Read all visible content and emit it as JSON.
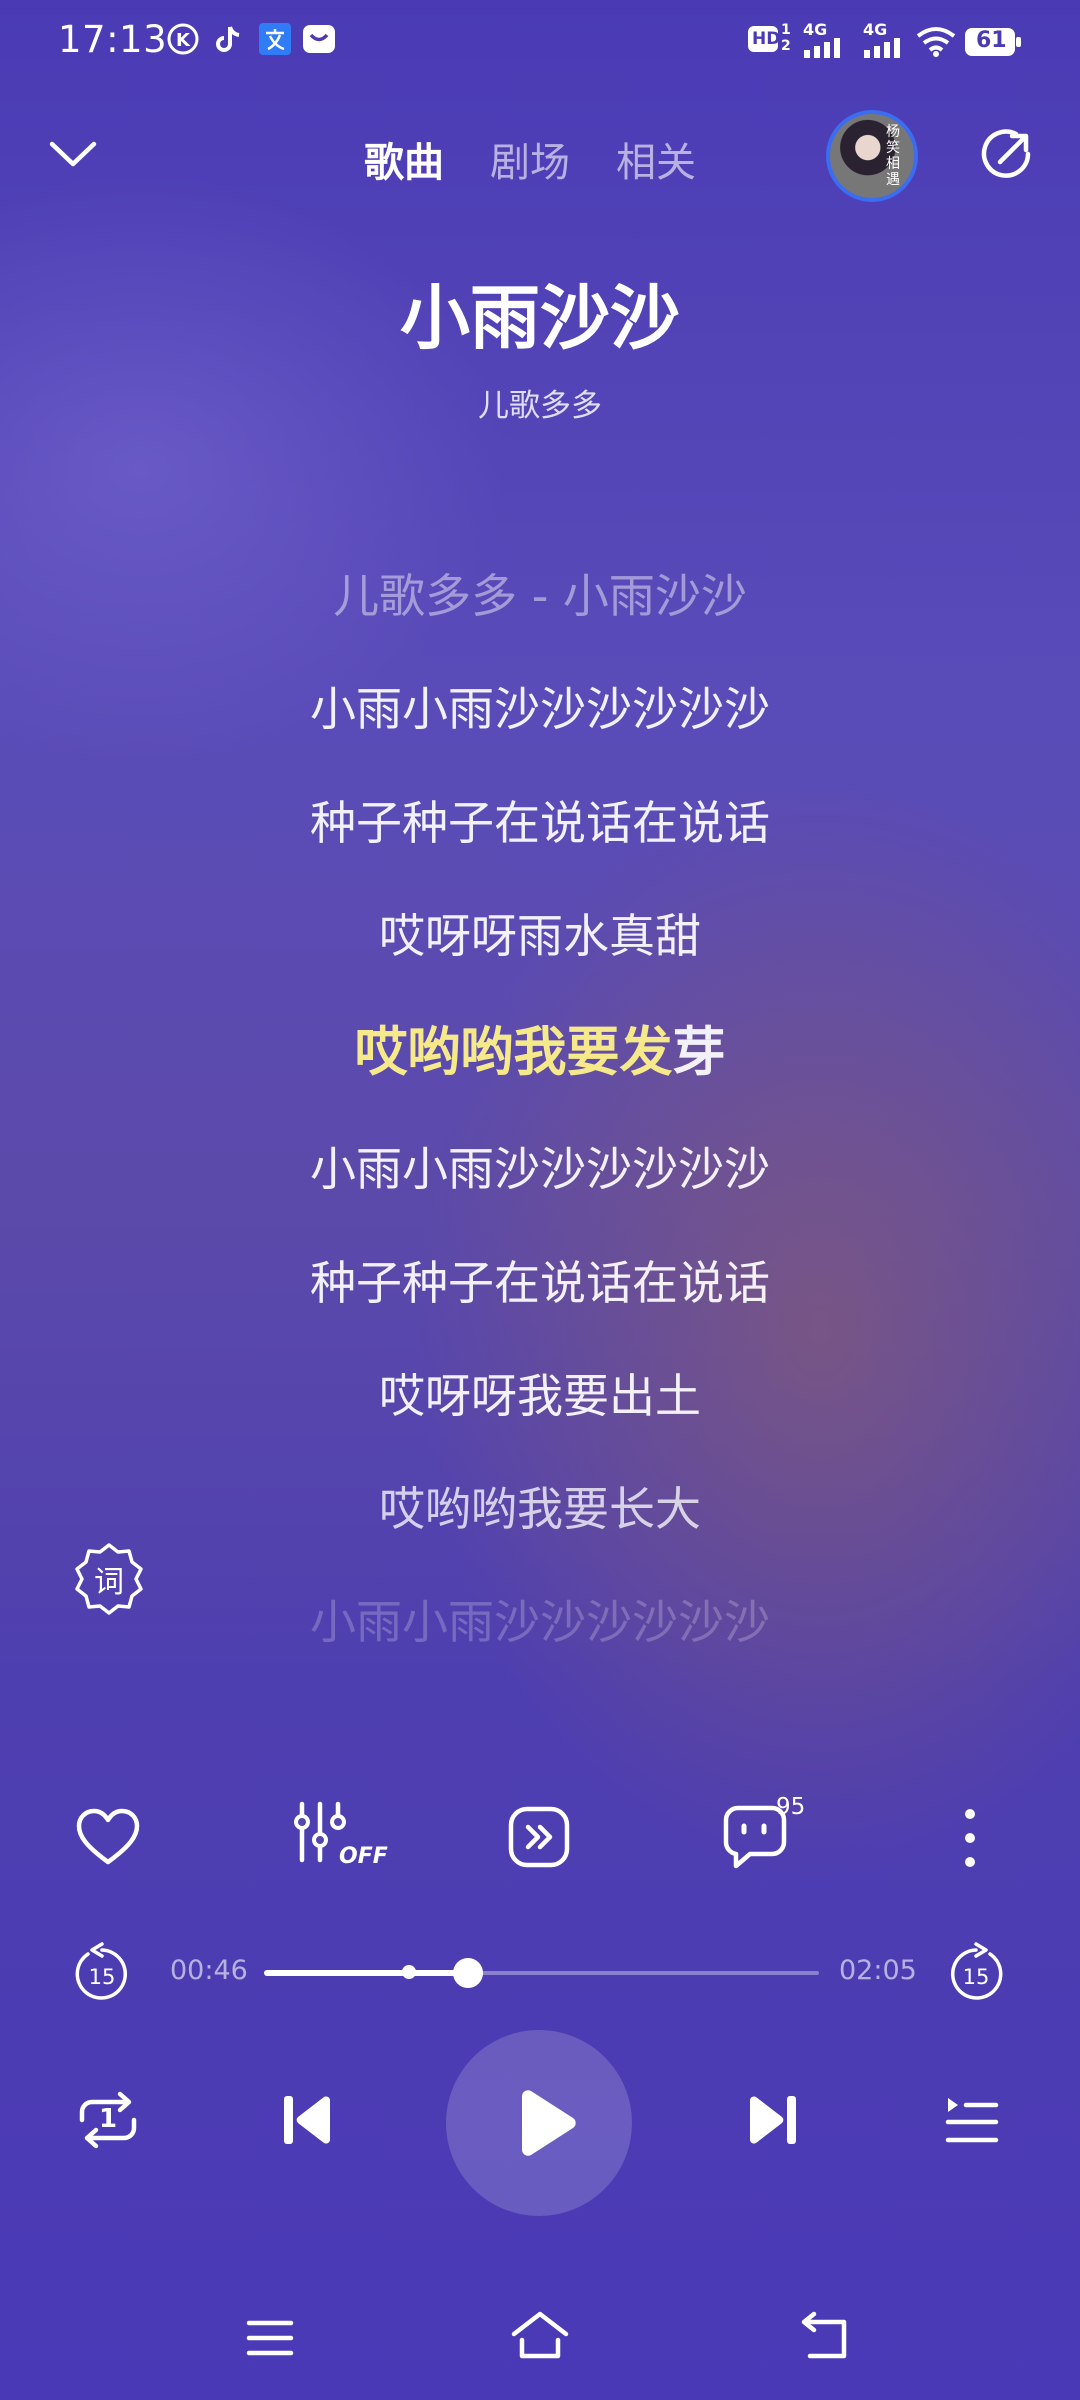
{
  "status_bar": {
    "time": "17:13",
    "left_icons": [
      "k-icon",
      "tiktok-icon",
      "translate-icon",
      "mail-icon"
    ],
    "right_icons": [
      "hd-icon",
      "signal-4g-icon",
      "signal-4g-icon",
      "wifi-icon",
      "battery-icon"
    ],
    "hd_label": "HD",
    "hd_sub": "1",
    "hd_sub2": "2",
    "network_1": "4G",
    "network_2": "4G",
    "battery_level": "61"
  },
  "header": {
    "tabs": [
      {
        "label": "歌曲",
        "active": true
      },
      {
        "label": "剧场",
        "active": false
      },
      {
        "label": "相关",
        "active": false
      }
    ],
    "avatar_text": "杨 笑 相 遇"
  },
  "song": {
    "title": "小雨沙沙",
    "artist": "儿歌多多"
  },
  "lyrics": {
    "lines": [
      "儿歌多多 - 小雨沙沙",
      "小雨小雨沙沙沙沙沙沙",
      "种子种子在说话在说话",
      "哎呀呀雨水真甜",
      "哎哟哟我要发芽",
      "小雨小雨沙沙沙沙沙沙",
      "种子种子在说话在说话",
      "哎呀呀我要出土",
      "哎哟哟我要长大",
      "小雨小雨沙沙沙沙沙沙"
    ],
    "current_index": 4,
    "current_highlighted": "哎哟哟我要发",
    "current_rest": "芽",
    "highlight_color": "#f5e98a",
    "lyric_button_label": "词"
  },
  "actions": {
    "equalizer_label": "OFF",
    "comment_count": "95"
  },
  "playback": {
    "elapsed": "00:46",
    "duration": "02:05",
    "progress": 0.368,
    "rewind_seconds": "15",
    "forward_seconds": "15",
    "repeat_label": "1",
    "state": "paused"
  },
  "theme": {
    "background": "#4a3bb5",
    "accent": "#f5e98a"
  }
}
